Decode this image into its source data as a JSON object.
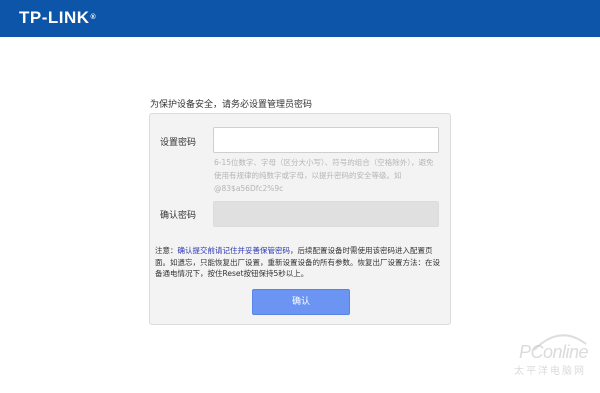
{
  "header": {
    "logo_text": "TP-LINK",
    "logo_mark": "®"
  },
  "intro": {
    "text": "为保护设备安全，请务必设置管理员密码"
  },
  "form": {
    "password_label": "设置密码",
    "password_value": "",
    "hint": "6-15位数字、字母（区分大小写）、符号的组合（空格除外），避免使用有规律的纯数字或字母，以提升密码的安全等级。如@83$a56Dfc2%9c",
    "confirm_label": "确认密码",
    "confirm_value": "",
    "note_prefix": "注意：",
    "note_warning": "确认提交前请记住并妥善保管密码",
    "note_rest": "，后续配置设备时需使用该密码进入配置页面。如遗忘，只能恢复出厂设置，重新设置设备的所有参数。恢复出厂设置方法：在设备通电情况下，按住Reset按钮保持5秒以上。",
    "confirm_button": "确认"
  },
  "watermark": {
    "brand": "PConline",
    "sub": "太平洋电脑网"
  },
  "colors": {
    "header_bg": "#0c55a9",
    "button_bg": "#6b94f3",
    "warning_text": "#2a36b5"
  }
}
